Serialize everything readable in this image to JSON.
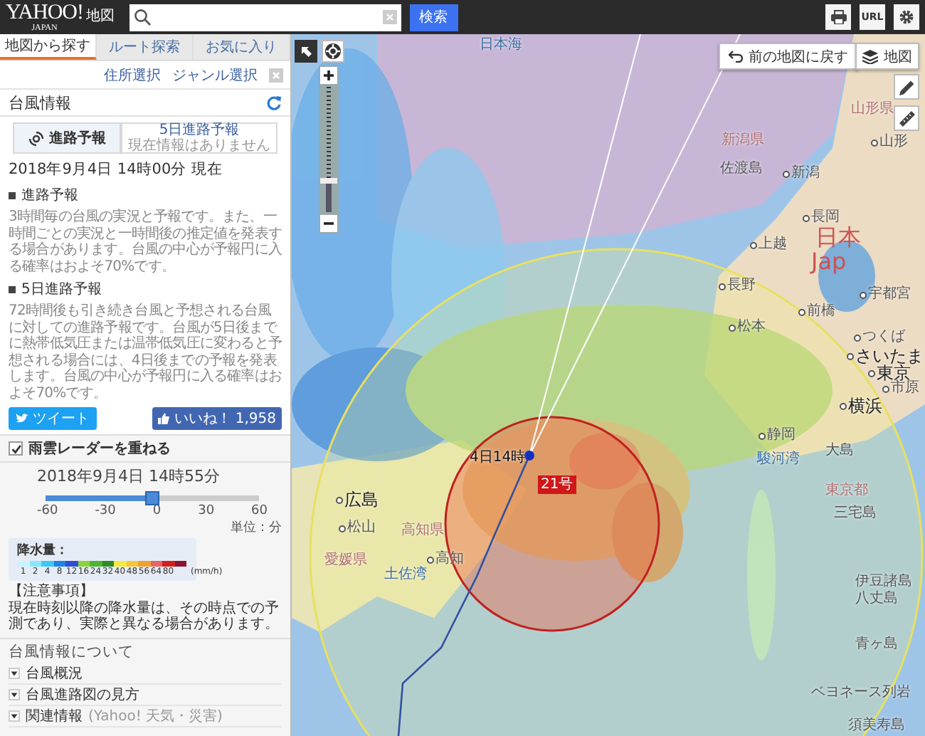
{
  "header": {
    "logo": "YAHOO!",
    "logo_sub": "JAPAN",
    "service": "地図",
    "search_button": "検索",
    "tools": [
      {
        "kind": "print"
      },
      {
        "kind": "url",
        "label": "URL"
      },
      {
        "kind": "settings"
      }
    ]
  },
  "sidebar": {
    "tabs": [
      {
        "label": "地図から探す",
        "selected": true
      },
      {
        "label": "ルート探索",
        "selected": false
      },
      {
        "label": "お気に入り",
        "selected": false
      }
    ],
    "filters": [
      "住所選択",
      "ジャンル選択"
    ],
    "title": "台風情報",
    "forecast_tabs": [
      {
        "label": "進路予報",
        "selected": true
      },
      {
        "label": "5日進路予報",
        "note": "現在情報はありません",
        "selected": false
      }
    ],
    "timestamp": "2018年9月4日 14時00分 現在",
    "sections": [
      {
        "heading": "進路予報",
        "text": "3時間毎の台風の実況と予報です。また、一時間ごとの実況と一時間後の推定値を発表する場合があります。台風の中心が予報円に入る確率はおよそ70%です。"
      },
      {
        "heading": "5日進路予報",
        "text": "72時間後も引き続き台風と予想される台風に対しての進路予報です。台風が5日後までに熱帯低気圧または温帯低気圧に変わると予想される場合には、4日後までの予報を発表します。台風の中心が予報円に入る確率はおよそ70%です。"
      }
    ],
    "share": {
      "tweet": "ツイート",
      "like": "いいね！",
      "like_count": "1,958"
    },
    "radar": {
      "label": "雨雲レーダーを重ねる",
      "checked": true,
      "time": "2018年9月4日  14時55分",
      "slider": {
        "level": 0.5,
        "ticks": [
          "-60",
          "-30",
          "0",
          "30",
          "60"
        ],
        "unit": "単位：分"
      },
      "legend": {
        "title": "降水量：",
        "unit": "(mm/h)",
        "steps": [
          {
            "label": "1",
            "color": "#c8f4ff"
          },
          {
            "label": "2",
            "color": "#8ae6ff"
          },
          {
            "label": "4",
            "color": "#3cc8f5"
          },
          {
            "label": "8",
            "color": "#1e82e6"
          },
          {
            "label": "12",
            "color": "#2d4fd2"
          },
          {
            "label": "16",
            "color": "#8cd23c"
          },
          {
            "label": "24",
            "color": "#50b432"
          },
          {
            "label": "32",
            "color": "#2d8c28"
          },
          {
            "label": "40",
            "color": "#f5eb3c"
          },
          {
            "label": "48",
            "color": "#f5c83c"
          },
          {
            "label": "56",
            "color": "#f0a032"
          },
          {
            "label": "64",
            "color": "#e66464"
          },
          {
            "label": "80",
            "color": "#d21e1e"
          },
          {
            "color": "#8c1432"
          }
        ]
      }
    },
    "notice": {
      "title": "【注意事項】",
      "text": "現在時刻以降の降水量は、その時点での予測であり、実際と異なる場合があります。"
    },
    "about": {
      "title": "台風情報について",
      "items": [
        {
          "label": "台風概況"
        },
        {
          "label": "台風進路図の見方"
        },
        {
          "label": "関連情報",
          "note": "(Yahoo! 天気・災害)"
        }
      ]
    }
  },
  "map": {
    "back_button": "前の地図に戻す",
    "layer_button": "地図",
    "zoom": {
      "level": 0.25
    },
    "typhoon": {
      "time_label": "4日14時",
      "name": "21号"
    },
    "labels": [
      {
        "text": "日本海",
        "kind": "sea"
      },
      {
        "text": "新潟県",
        "kind": "prefecture"
      },
      {
        "text": "佐渡島",
        "kind": "island"
      },
      {
        "text": "新潟",
        "kind": "city"
      },
      {
        "text": "山形県",
        "kind": "prefecture"
      },
      {
        "text": "山形",
        "kind": "city"
      },
      {
        "text": "長岡",
        "kind": "city"
      },
      {
        "text": "上越",
        "kind": "city"
      },
      {
        "text": "長野",
        "kind": "city"
      },
      {
        "text": "松本",
        "kind": "city"
      },
      {
        "text": "宇都宮",
        "kind": "city"
      },
      {
        "text": "前橋",
        "kind": "city"
      },
      {
        "text": "さいたま",
        "kind": "major"
      },
      {
        "text": "東京",
        "kind": "major"
      },
      {
        "text": "横浜",
        "kind": "major"
      },
      {
        "text": "静岡",
        "kind": "city"
      },
      {
        "text": "大島",
        "kind": "island"
      },
      {
        "text": "広島",
        "kind": "major"
      },
      {
        "text": "松山",
        "kind": "city"
      },
      {
        "text": "高知",
        "kind": "city"
      },
      {
        "text": "土佐湾",
        "kind": "sea"
      },
      {
        "text": "東京都",
        "kind": "prefecture"
      },
      {
        "text": "三宅島",
        "kind": "island"
      },
      {
        "text": "伊豆諸島",
        "kind": "island"
      },
      {
        "text": "八丈島",
        "kind": "island"
      },
      {
        "text": "青ヶ島",
        "kind": "island"
      },
      {
        "text": "ベヨネース列岩",
        "kind": "island"
      },
      {
        "text": "須美寿島",
        "kind": "island"
      },
      {
        "text": "日本",
        "kind": "country"
      },
      {
        "text": "Jap",
        "kind": "country"
      },
      {
        "text": "駿河湾",
        "kind": "sea"
      },
      {
        "text": "高知県",
        "kind": "prefecture"
      },
      {
        "text": "愛媛県",
        "kind": "prefecture"
      },
      {
        "text": "つくば",
        "kind": "city"
      },
      {
        "text": "市原",
        "kind": "city"
      }
    ]
  }
}
